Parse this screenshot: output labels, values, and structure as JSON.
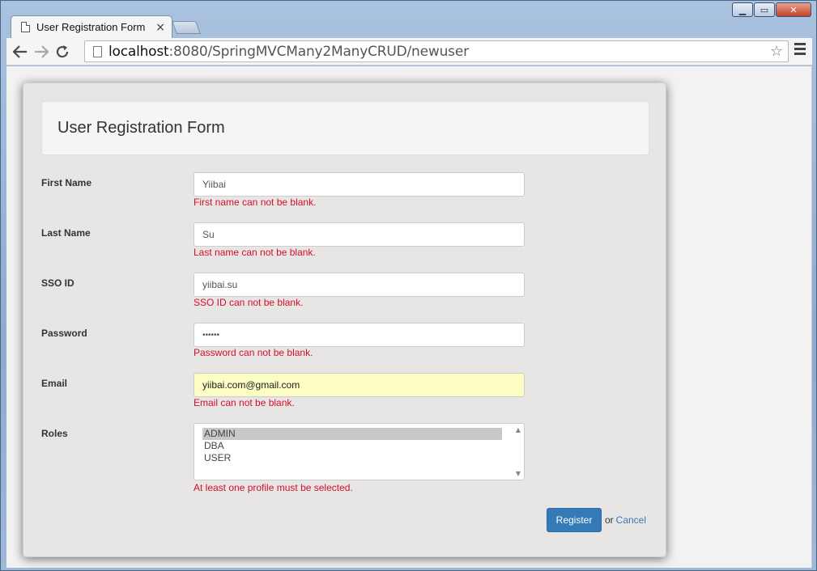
{
  "browser": {
    "tab_title": "User Registration Form",
    "tab_close": "×",
    "url_host": "localhost",
    "url_rest": ":8080/SpringMVCMany2ManyCRUD/newuser"
  },
  "form": {
    "heading": "User Registration Form",
    "fields": [
      {
        "label": "First Name",
        "value": "Yiibai",
        "error": "First name can not be blank."
      },
      {
        "label": "Last Name",
        "value": "Su",
        "error": "Last name can not be blank."
      },
      {
        "label": "SSO ID",
        "value": "yiibai.su",
        "error": "SSO ID can not be blank."
      },
      {
        "label": "Password",
        "value": "••••••",
        "error": "Password can not be blank."
      },
      {
        "label": "Email",
        "value": "yiibai.com@gmail.com",
        "error": "Email can not be blank."
      }
    ],
    "roles": {
      "label": "Roles",
      "options": [
        "ADMIN",
        "DBA",
        "USER"
      ],
      "selected": "ADMIN",
      "error": "At least one profile must be selected."
    },
    "register_label": "Register",
    "or_text": "or",
    "cancel_label": "Cancel"
  },
  "colors": {
    "primary": "#337ab7",
    "error": "#d40e2d",
    "autofill": "#fbfdc2"
  }
}
